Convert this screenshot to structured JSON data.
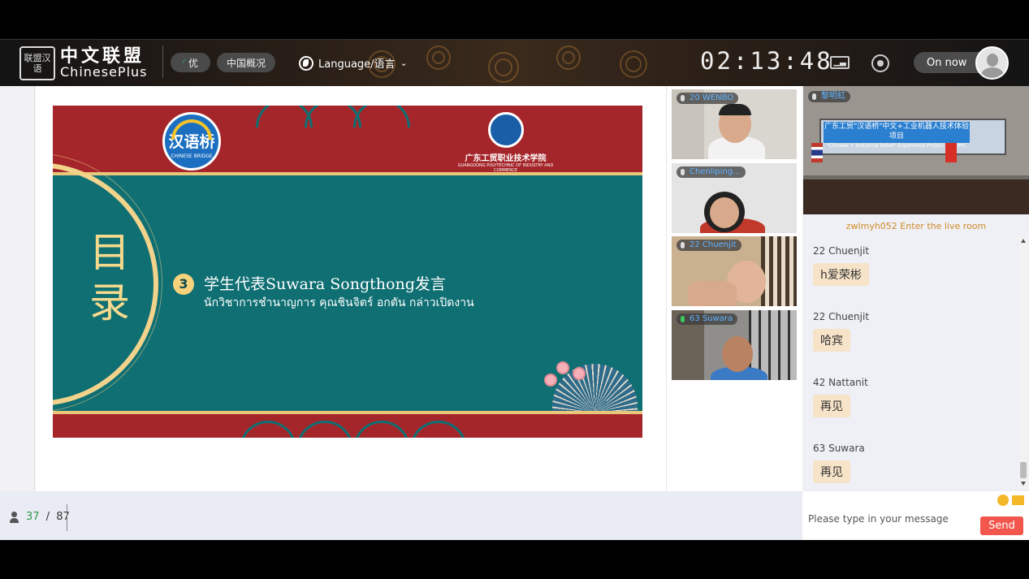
{
  "header": {
    "logo_seal": "联盟汉语",
    "logo_cn": "中文联盟",
    "logo_en": "ChinesePlus",
    "quality_label": "优",
    "china_overview_label": "中国概况",
    "language_label": "Language/语言",
    "timer": "02:13:48",
    "on_now_label": "On now"
  },
  "slide": {
    "logo_left_cn": "汉语桥",
    "logo_left_en": "CHINESE BRIDGE",
    "logo_right_cn": "广东工贸职业技术学院",
    "logo_right_en": "GUANGDONG POLYTECHNIC OF INDUSTRY AND COMMERCE",
    "side_title": "目录",
    "item_number": "3",
    "item_title": "学生代表Suwara Songthong发言",
    "item_subtitle": "นักวิชาการชำนาญการ คุณชินจิตร์ อกตัน กล่าวเปิดงาน"
  },
  "videos": [
    {
      "label": "20 WENBO"
    },
    {
      "label": "Chenliping..."
    },
    {
      "label": "22 Chuenjit"
    },
    {
      "label": "63 Suwara"
    }
  ],
  "room_video": {
    "label": "黎明虹",
    "banner_line1": "广东工贸\"汉语桥\"中文+工业机器人技术体验项目",
    "banner_line2": "\"Chinese + Industrial Robot\" Experience Project of GDPIC"
  },
  "chat": {
    "system_message": "zwlmyh052 Enter the live room",
    "messages": [
      {
        "sender": "22 Chuenjit",
        "text": "h爱荣彬"
      },
      {
        "sender": "22 Chuenjit",
        "text": "哈宾"
      },
      {
        "sender": "42 Nattanit",
        "text": "再见"
      },
      {
        "sender": "63 Suwara",
        "text": "再见"
      }
    ],
    "input_placeholder": "Please type in your message",
    "send_label": "Send"
  },
  "page": {
    "current": "37",
    "separator": " / ",
    "total": "87"
  }
}
